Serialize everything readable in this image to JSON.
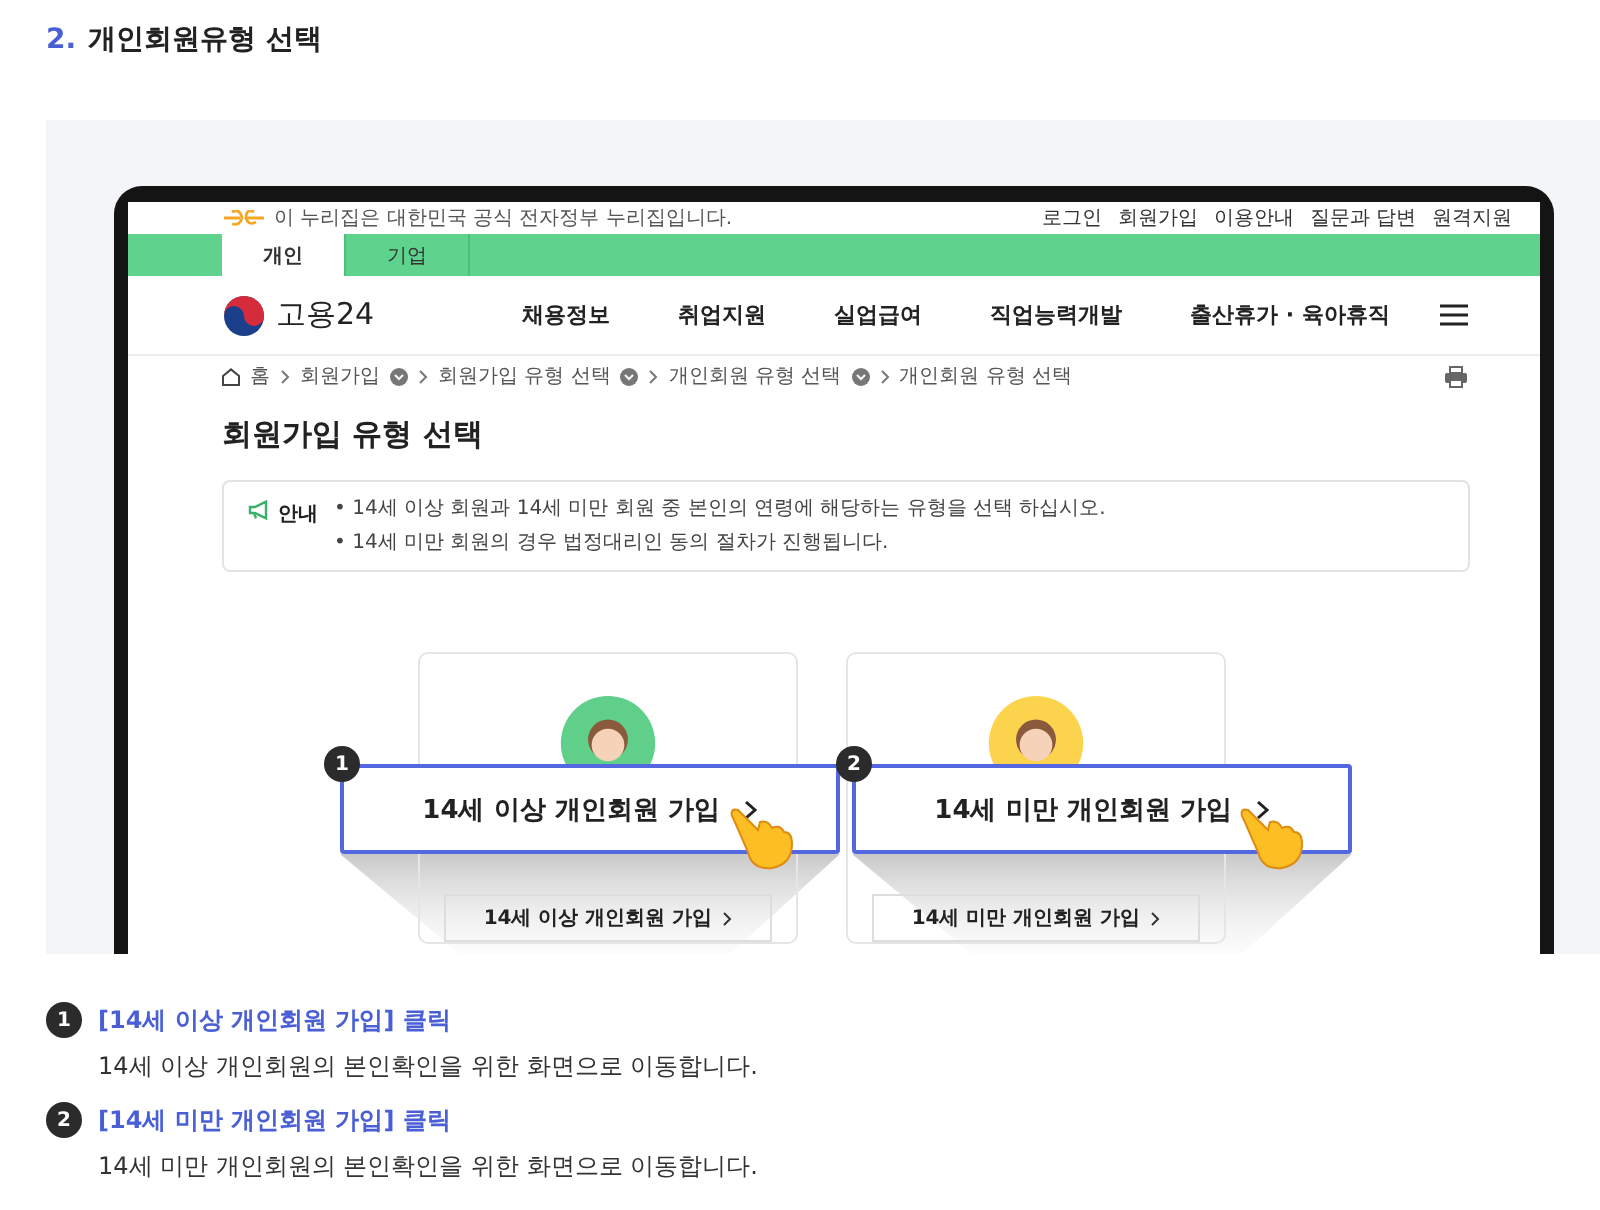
{
  "heading": {
    "number": "2.",
    "title": "개인회원유형 선택"
  },
  "mockup": {
    "gov_banner": "이 누리집은 대한민국 공식 전자정부 누리집입니다.",
    "utility_links": [
      "로그인",
      "회원가입",
      "이용안내",
      "질문과 답변",
      "원격지원"
    ],
    "audience_tabs": [
      {
        "label": "개인",
        "selected": true
      },
      {
        "label": "기업",
        "selected": false
      }
    ],
    "logo_text": "고용24",
    "main_menu": [
      "채용정보",
      "취업지원",
      "실업급여",
      "직업능력개발",
      "출산휴가 · 육아휴직"
    ],
    "breadcrumb": [
      {
        "label": "홈",
        "dropdown": false
      },
      {
        "label": "회원가입",
        "dropdown": true
      },
      {
        "label": "회원가입 유형 선택",
        "dropdown": true
      },
      {
        "label": "개인회원 유형 선택",
        "dropdown": true
      },
      {
        "label": "개인회원 유형 선택",
        "dropdown": false
      }
    ],
    "page_title": "회원가입 유형 선택",
    "notice": {
      "label": "안내",
      "lines": [
        "• 14세 이상 회원과 14세 미만 회원 중 본인의 연령에 해당하는 유형을 선택 하십시오.",
        "• 14세 미만 회원의 경우 법정대리인 동의 절차가 진행됩니다."
      ]
    },
    "cards": [
      {
        "color": "#5fcf8a",
        "button": "14세 이상 개인회원 가입",
        "callout_number": "1",
        "callout_label": "14세 이상 개인회원 가입"
      },
      {
        "color": "#fcd34d",
        "button": "14세 미만 개인회원 가입",
        "callout_number": "2",
        "callout_label": "14세 미만 개인회원 가입"
      }
    ]
  },
  "steps": [
    {
      "number": "1",
      "title": "[14세 이상 개인회원 가입] 클릭",
      "description": "14세 이상 개인회원의 본인확인을 위한 화면으로 이동합니다."
    },
    {
      "number": "2",
      "title": "[14세 미만 개인회원 가입] 클릭",
      "description": "14세 미만 개인회원의 본인확인을 위한 화면으로 이동합니다."
    }
  ]
}
